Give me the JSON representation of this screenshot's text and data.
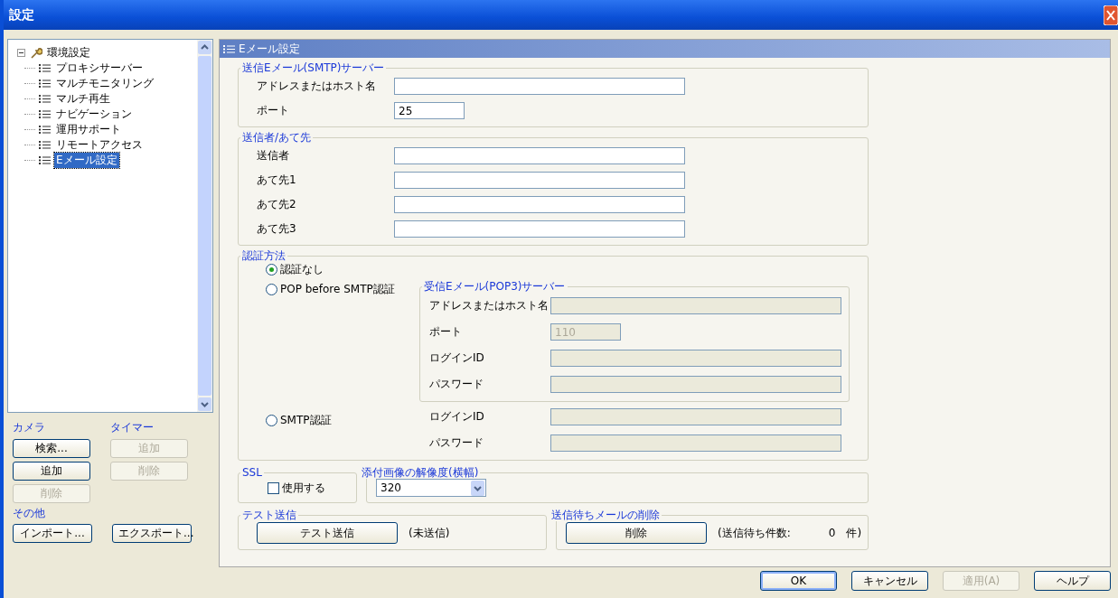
{
  "window": {
    "title": "設定"
  },
  "tree": {
    "label": "環境設定",
    "expanded": true,
    "children": [
      {
        "label": "プロキシサーバー",
        "selected": false
      },
      {
        "label": "マルチモニタリング",
        "selected": false
      },
      {
        "label": "マルチ再生",
        "selected": false
      },
      {
        "label": "ナビゲーション",
        "selected": false
      },
      {
        "label": "運用サポート",
        "selected": false
      },
      {
        "label": "リモートアクセス",
        "selected": false
      },
      {
        "label": "Eメール設定",
        "selected": true
      }
    ]
  },
  "camera": {
    "title": "カメラ",
    "buttons": [
      {
        "label": "検索...",
        "disabled": false
      },
      {
        "label": "追加",
        "disabled": false
      },
      {
        "label": "削除",
        "disabled": true
      }
    ]
  },
  "timer": {
    "title": "タイマー",
    "buttons": [
      {
        "label": "追加",
        "disabled": true
      },
      {
        "label": "削除",
        "disabled": true
      }
    ]
  },
  "other": {
    "title": "その他",
    "buttons": [
      {
        "label": "インポート...",
        "disabled": false
      },
      {
        "label": "エクスポート...",
        "disabled": false
      }
    ]
  },
  "panel": {
    "title": "Eメール設定"
  },
  "smtp_server": {
    "title": "送信Eメール(SMTP)サーバー",
    "fields": [
      {
        "label": "アドレスまたはホスト名",
        "kind": "wide",
        "disabled": false
      },
      {
        "label": "ポート",
        "value": "25",
        "kind": "short",
        "disabled": false
      }
    ]
  },
  "recipients": {
    "title": "送信者/あて先",
    "fields": [
      {
        "label": "送信者",
        "disabled": false
      },
      {
        "label": "あて先1",
        "disabled": false
      },
      {
        "label": "あて先2",
        "disabled": false
      },
      {
        "label": "あて先3",
        "disabled": false
      }
    ]
  },
  "auth": {
    "title": "認証方法",
    "options": [
      {
        "label": "認証なし",
        "selected": true
      },
      {
        "label": "POP before SMTP認証",
        "selected": false
      },
      {
        "label": "SMTP認証",
        "selected": false
      }
    ],
    "pop3": {
      "title": "受信Eメール(POP3)サーバー",
      "fields": [
        {
          "label": "アドレスまたはホスト名",
          "kind": "wide",
          "disabled": true
        },
        {
          "label": "ポート",
          "value": "110",
          "kind": "short",
          "disabled": true
        },
        {
          "label": "ログインID",
          "kind": "wide",
          "disabled": true
        },
        {
          "label": "パスワード",
          "kind": "wide",
          "disabled": true
        }
      ]
    },
    "smtp_fields": [
      {
        "label": "ログインID",
        "disabled": true
      },
      {
        "label": "パスワード",
        "disabled": true
      }
    ]
  },
  "ssl": {
    "title": "SSL",
    "checkbox": {
      "label": "使用する",
      "checked": false
    }
  },
  "resolution": {
    "title": "添付画像の解像度(横幅)",
    "value": "320"
  },
  "test_send": {
    "title": "テスト送信",
    "button": "テスト送信",
    "status": "(未送信)"
  },
  "queue": {
    "title": "送信待ちメールの削除",
    "button": "削除",
    "label": "(送信待ち件数:",
    "count": "0",
    "unit": "件)"
  },
  "footer": [
    {
      "label": "OK",
      "disabled": false,
      "default": true
    },
    {
      "label": "キャンセル",
      "disabled": false,
      "default": false
    },
    {
      "label": "適用(A)",
      "disabled": true,
      "default": false
    },
    {
      "label": "ヘルプ",
      "disabled": false,
      "default": false
    }
  ]
}
